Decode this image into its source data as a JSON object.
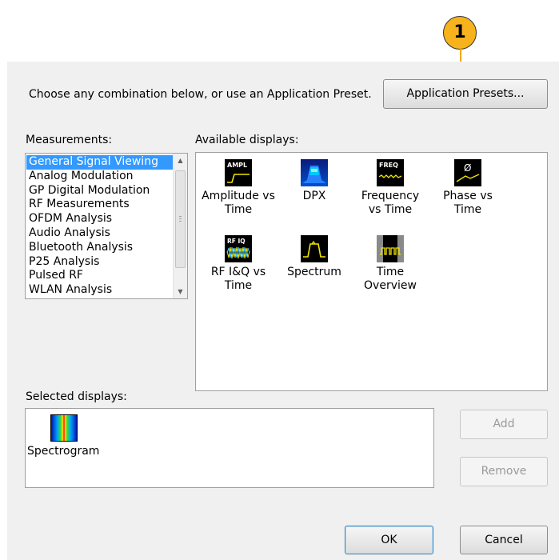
{
  "callout": {
    "number": "1"
  },
  "header": {
    "instruction": "Choose any combination below, or use an Application Preset.",
    "presets_button": "Application Presets..."
  },
  "measurements": {
    "label": "Measurements:",
    "items": [
      "General Signal Viewing",
      "Analog Modulation",
      "GP Digital Modulation",
      "RF Measurements",
      "OFDM Analysis",
      "Audio Analysis",
      "Bluetooth Analysis",
      "P25 Analysis",
      "Pulsed RF",
      "WLAN Analysis"
    ],
    "selected": "General Signal Viewing"
  },
  "available": {
    "label": "Available displays:",
    "items": [
      {
        "line1": "Amplitude vs",
        "line2": "Time",
        "icon": "amplitude-vs-time-icon",
        "icon_text": "AMPL"
      },
      {
        "line1": "DPX",
        "line2": "",
        "icon": "dpx-icon",
        "icon_text": ""
      },
      {
        "line1": "Frequency",
        "line2": "vs Time",
        "icon": "frequency-vs-time-icon",
        "icon_text": "FREQ"
      },
      {
        "line1": "Phase vs",
        "line2": "Time",
        "icon": "phase-vs-time-icon",
        "icon_text": "Ø"
      },
      {
        "line1": "RF I&Q vs",
        "line2": "Time",
        "icon": "rf-iq-vs-time-icon",
        "icon_text": "RF IQ"
      },
      {
        "line1": "Spectrum",
        "line2": "",
        "icon": "spectrum-icon",
        "icon_text": ""
      },
      {
        "line1": "Time",
        "line2": "Overview",
        "icon": "time-overview-icon",
        "icon_text": ""
      }
    ]
  },
  "selected_displays": {
    "label": "Selected displays:",
    "items": [
      {
        "label": "Spectrogram",
        "icon": "spectrogram-icon"
      }
    ]
  },
  "buttons": {
    "add": "Add",
    "remove": "Remove",
    "ok": "OK",
    "cancel": "Cancel"
  }
}
